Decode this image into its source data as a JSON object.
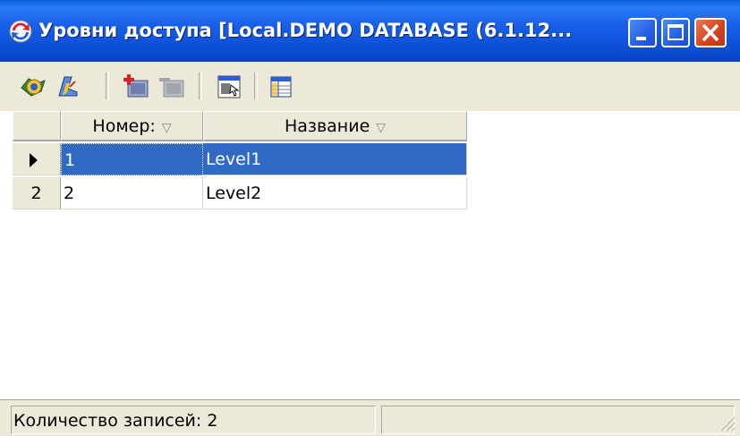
{
  "window": {
    "title": "Уровни доступа [Local.DEMO DATABASE (6.1.12...",
    "icon": "refresh-arrows-icon",
    "buttons": [
      "minimize",
      "maximize",
      "close"
    ]
  },
  "toolbar": {
    "buttons": [
      "globe-icon",
      "funnel-icon",
      "add-record-icon",
      "delete-record-icon",
      "properties-icon",
      "columns-icon"
    ]
  },
  "grid": {
    "columns": [
      {
        "label": "Номер:",
        "sort_icon": "▽"
      },
      {
        "label": "Название",
        "sort_icon": "▽"
      }
    ],
    "rows": [
      {
        "indicator": "",
        "number": "1",
        "name": "Level1",
        "selected": true
      },
      {
        "indicator": "2",
        "number": "2",
        "name": "Level2",
        "selected": false
      }
    ]
  },
  "statusbar": {
    "record_count": "Количество записей: 2",
    "panel2": ""
  },
  "colors": {
    "title_bar": "#0b50d8",
    "selection": "#316ac5",
    "chrome": "#ece9d8",
    "close_button": "#d6451f"
  }
}
